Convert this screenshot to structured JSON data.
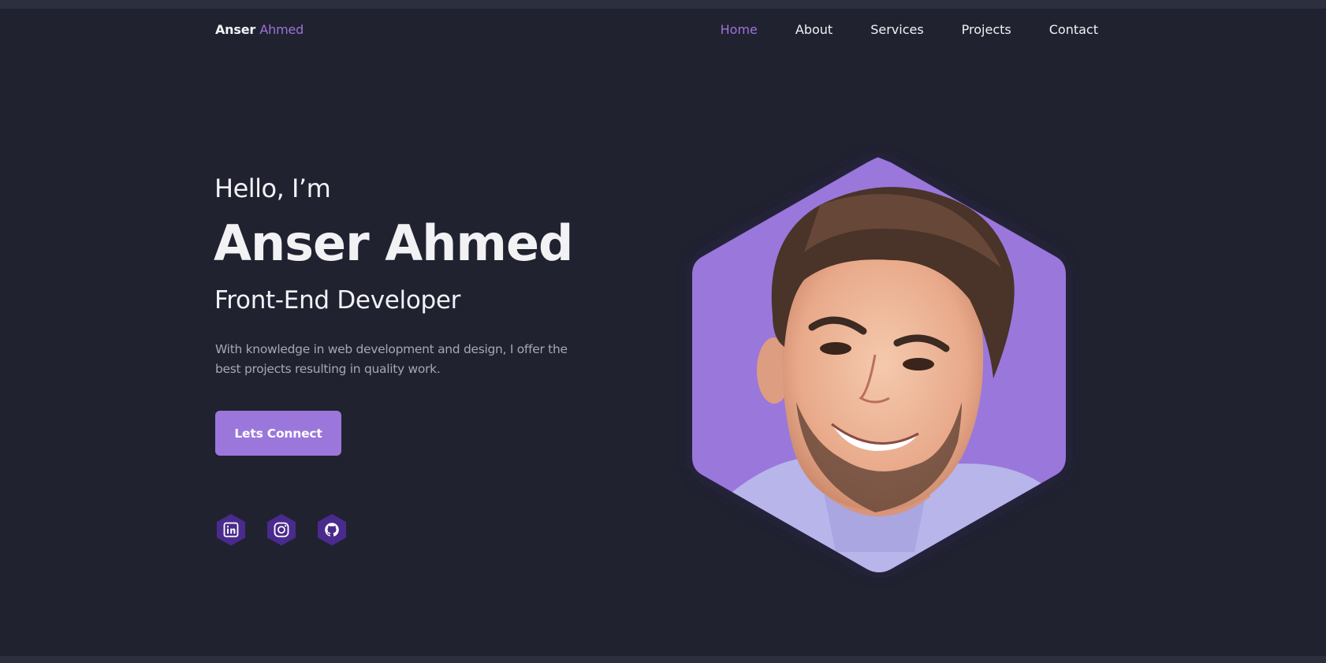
{
  "header": {
    "logo_first": "Anser",
    "logo_last": "Ahmed",
    "nav": [
      "Home",
      "About",
      "Services",
      "Projects",
      "Contact"
    ],
    "active_nav": "Home"
  },
  "hero": {
    "greeting": "Hello, I’m",
    "name": "Anser Ahmed",
    "role": "Front-End Developer",
    "description": "With knowledge in web development and design, I offer the best projects resulting in quality work.",
    "cta_label": "Lets Connect"
  },
  "socials": [
    {
      "icon": "linkedin-icon"
    },
    {
      "icon": "instagram-icon"
    },
    {
      "icon": "github-icon"
    }
  ],
  "colors": {
    "background": "#202230",
    "accent": "#9b74da",
    "social_bg": "#4a2a8c"
  }
}
